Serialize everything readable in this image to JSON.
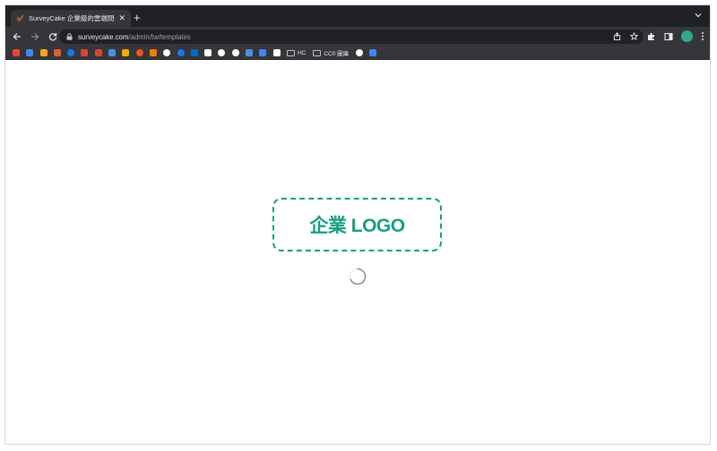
{
  "browser": {
    "tab": {
      "title": "SurveyCake 企業級的雲端問卷",
      "favicon": "surveycake-check-icon"
    },
    "address": {
      "host": "surveycake.com",
      "path": "/admin/tw/templates"
    },
    "bookmarks": {
      "folders": [
        {
          "label": "HC"
        },
        {
          "label": "CC0 圖庫"
        }
      ],
      "icon_colors": [
        "#e8453c",
        "#4285f4",
        "#fca326",
        "#e55b2d",
        "#1877f2",
        "#d44638",
        "#d44638",
        "#4a90e2",
        "#f9ab00",
        "#f4511e",
        "#f57c00",
        "#ffffff",
        "#1877f2",
        "#0a66c2",
        "#ffffff",
        "#ffffff",
        "#ffffff",
        "#4a90e2",
        "#4285f4",
        "#ffffff"
      ]
    }
  },
  "page": {
    "logo_text": "企業 LOGO",
    "accent_color": "#179f7f",
    "loading": true
  }
}
